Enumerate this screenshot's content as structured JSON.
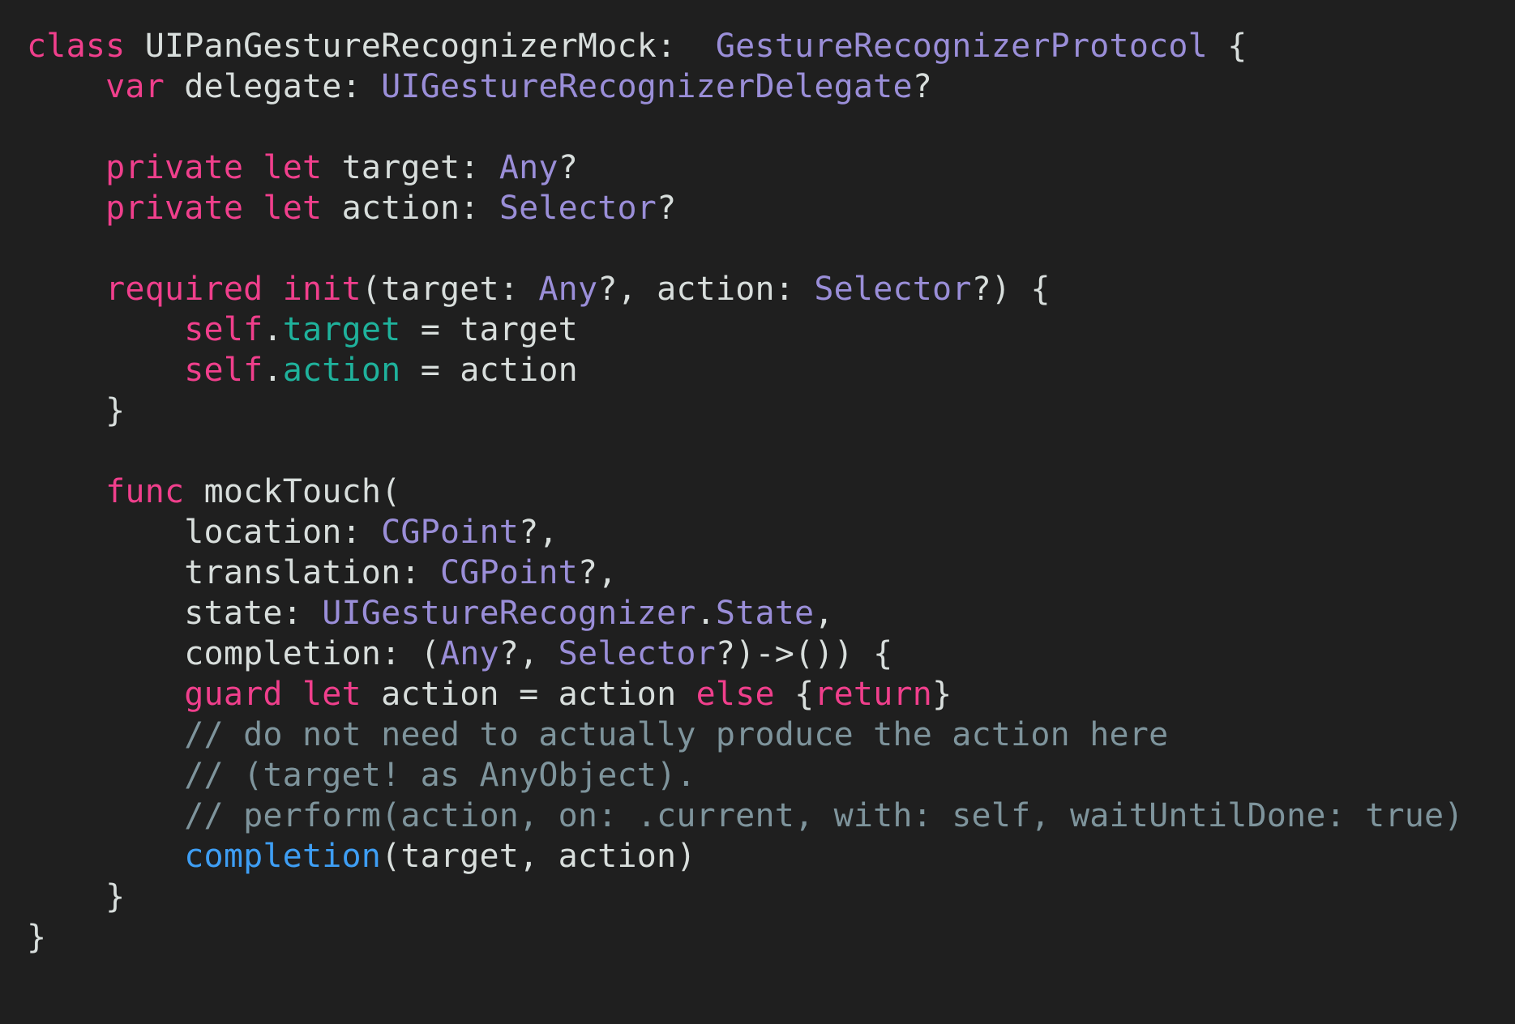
{
  "colors": {
    "background": "#1f1f1f",
    "plain": "#d8dedc",
    "keyword": "#f03f8c",
    "type": "#9a8ed8",
    "property": "#1fb29c",
    "call": "#3e9ef4",
    "comment": "#7e949c"
  },
  "code": {
    "lines": [
      [
        {
          "t": "class",
          "k": "kw"
        },
        {
          "t": " UIPanGestureRecognizerMock:  ",
          "k": "plain"
        },
        {
          "t": "GestureRecognizerProtocol",
          "k": "type"
        },
        {
          "t": " {",
          "k": "plain"
        }
      ],
      [
        {
          "t": "    ",
          "k": "plain"
        },
        {
          "t": "var",
          "k": "kw"
        },
        {
          "t": " delegate: ",
          "k": "plain"
        },
        {
          "t": "UIGestureRecognizerDelegate",
          "k": "type"
        },
        {
          "t": "?",
          "k": "plain"
        }
      ],
      [],
      [
        {
          "t": "    ",
          "k": "plain"
        },
        {
          "t": "private",
          "k": "kw"
        },
        {
          "t": " ",
          "k": "plain"
        },
        {
          "t": "let",
          "k": "kw"
        },
        {
          "t": " target: ",
          "k": "plain"
        },
        {
          "t": "Any",
          "k": "type"
        },
        {
          "t": "?",
          "k": "plain"
        }
      ],
      [
        {
          "t": "    ",
          "k": "plain"
        },
        {
          "t": "private",
          "k": "kw"
        },
        {
          "t": " ",
          "k": "plain"
        },
        {
          "t": "let",
          "k": "kw"
        },
        {
          "t": " action: ",
          "k": "plain"
        },
        {
          "t": "Selector",
          "k": "type"
        },
        {
          "t": "?",
          "k": "plain"
        }
      ],
      [],
      [
        {
          "t": "    ",
          "k": "plain"
        },
        {
          "t": "required",
          "k": "kw"
        },
        {
          "t": " ",
          "k": "plain"
        },
        {
          "t": "init",
          "k": "kw"
        },
        {
          "t": "(target: ",
          "k": "plain"
        },
        {
          "t": "Any",
          "k": "type"
        },
        {
          "t": "?, action: ",
          "k": "plain"
        },
        {
          "t": "Selector",
          "k": "type"
        },
        {
          "t": "?) {",
          "k": "plain"
        }
      ],
      [
        {
          "t": "        ",
          "k": "plain"
        },
        {
          "t": "self",
          "k": "kw"
        },
        {
          "t": ".",
          "k": "plain"
        },
        {
          "t": "target",
          "k": "prop"
        },
        {
          "t": " = target",
          "k": "plain"
        }
      ],
      [
        {
          "t": "        ",
          "k": "plain"
        },
        {
          "t": "self",
          "k": "kw"
        },
        {
          "t": ".",
          "k": "plain"
        },
        {
          "t": "action",
          "k": "prop"
        },
        {
          "t": " = action",
          "k": "plain"
        }
      ],
      [
        {
          "t": "    }",
          "k": "plain"
        }
      ],
      [],
      [
        {
          "t": "    ",
          "k": "plain"
        },
        {
          "t": "func",
          "k": "kw"
        },
        {
          "t": " mockTouch(",
          "k": "plain"
        }
      ],
      [
        {
          "t": "        location: ",
          "k": "plain"
        },
        {
          "t": "CGPoint",
          "k": "type"
        },
        {
          "t": "?,",
          "k": "plain"
        }
      ],
      [
        {
          "t": "        translation: ",
          "k": "plain"
        },
        {
          "t": "CGPoint",
          "k": "type"
        },
        {
          "t": "?,",
          "k": "plain"
        }
      ],
      [
        {
          "t": "        state: ",
          "k": "plain"
        },
        {
          "t": "UIGestureRecognizer",
          "k": "type"
        },
        {
          "t": ".",
          "k": "plain"
        },
        {
          "t": "State",
          "k": "type"
        },
        {
          "t": ",",
          "k": "plain"
        }
      ],
      [
        {
          "t": "        completion: (",
          "k": "plain"
        },
        {
          "t": "Any",
          "k": "type"
        },
        {
          "t": "?, ",
          "k": "plain"
        },
        {
          "t": "Selector",
          "k": "type"
        },
        {
          "t": "?)->()) {",
          "k": "plain"
        }
      ],
      [
        {
          "t": "        ",
          "k": "plain"
        },
        {
          "t": "guard",
          "k": "kw"
        },
        {
          "t": " ",
          "k": "plain"
        },
        {
          "t": "let",
          "k": "kw"
        },
        {
          "t": " action = action ",
          "k": "plain"
        },
        {
          "t": "else",
          "k": "kw"
        },
        {
          "t": " {",
          "k": "plain"
        },
        {
          "t": "return",
          "k": "kw"
        },
        {
          "t": "}",
          "k": "plain"
        }
      ],
      [
        {
          "t": "        ",
          "k": "plain"
        },
        {
          "t": "// do not need to actually produce the action here",
          "k": "comment"
        }
      ],
      [
        {
          "t": "        ",
          "k": "plain"
        },
        {
          "t": "// (target! as AnyObject).",
          "k": "comment"
        }
      ],
      [
        {
          "t": "        ",
          "k": "plain"
        },
        {
          "t": "// perform(action, on: .current, with: self, waitUntilDone: true)",
          "k": "comment"
        }
      ],
      [
        {
          "t": "        ",
          "k": "plain"
        },
        {
          "t": "completion",
          "k": "call"
        },
        {
          "t": "(target, action)",
          "k": "plain"
        }
      ],
      [
        {
          "t": "    }",
          "k": "plain"
        }
      ],
      [
        {
          "t": "}",
          "k": "plain"
        }
      ]
    ]
  }
}
